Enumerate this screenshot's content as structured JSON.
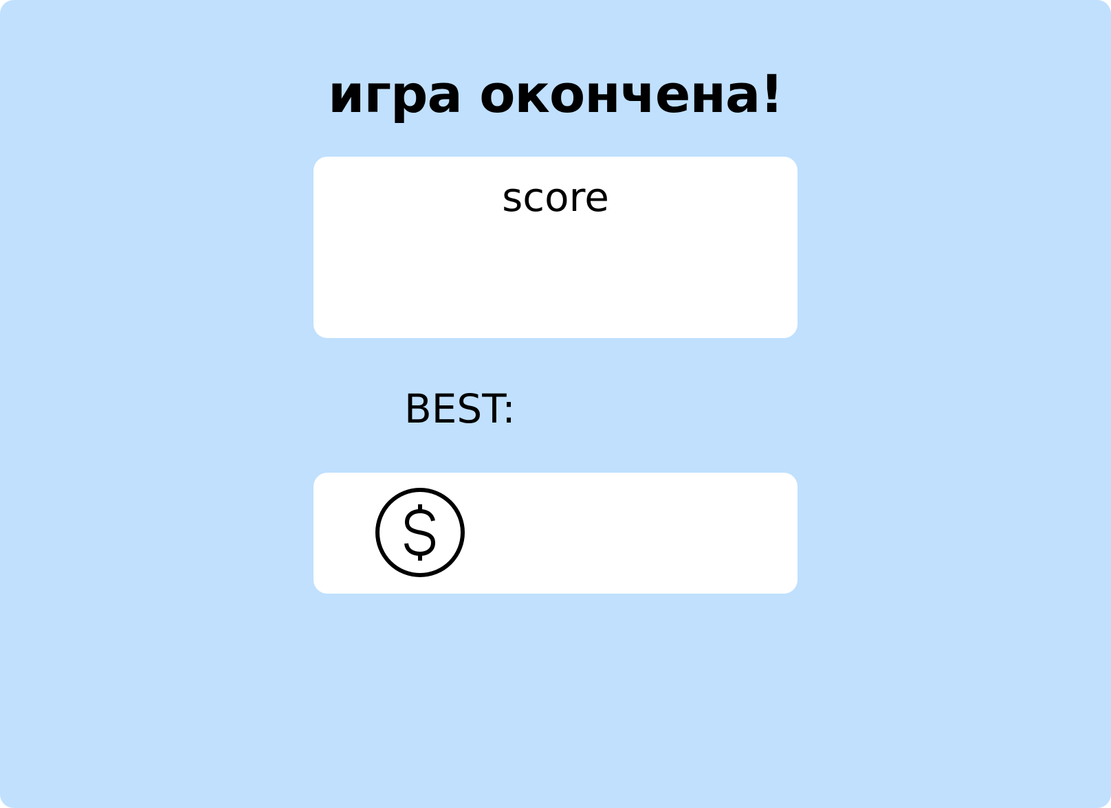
{
  "screen": {
    "title": "игра окончена!",
    "score_label": "score",
    "best_label": "BEST:",
    "coin_icon": "dollar-coin-icon",
    "background_color": "#c0e0fe",
    "card_color": "#ffffff"
  }
}
